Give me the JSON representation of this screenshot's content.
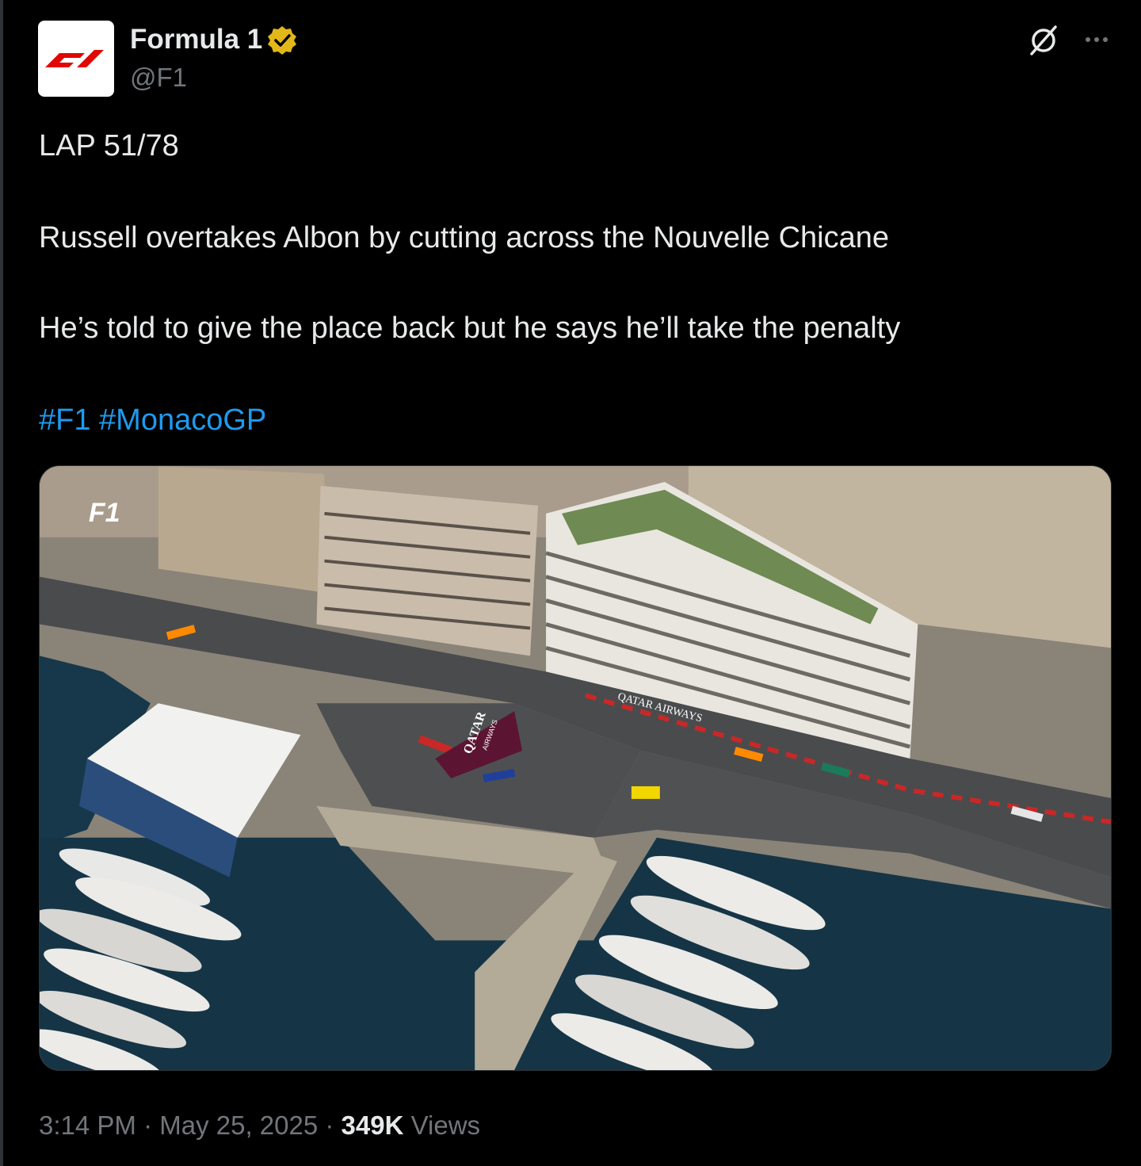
{
  "author": {
    "display_name": "Formula 1",
    "handle": "@F1",
    "verified": true,
    "avatar_icon": "f1-logo-icon",
    "brand_color": "#e10600"
  },
  "header_actions": {
    "grok_icon": "grok-icon",
    "more_icon": "more-options-icon"
  },
  "tweet": {
    "line1": "LAP 51/78",
    "line2": "Russell overtakes Albon by cutting across the Nouvelle Chicane",
    "line3": "He’s told to give the place back but he says he’ll take the penalty",
    "hashtag1": "#F1",
    "hashtag2": "#MonacoGP",
    "hashtag_color": "#1d9bf0"
  },
  "media": {
    "watermark": "F1",
    "track_sign": "QATAR AIRWAYS",
    "chicane_logo_line1": "QATAR",
    "chicane_logo_line2": "AIRWAYS"
  },
  "meta": {
    "time": "3:14 PM",
    "sep1": " · ",
    "date": "May 25, 2025",
    "sep2": " · ",
    "views_count": "349K",
    "views_label": " Views"
  }
}
